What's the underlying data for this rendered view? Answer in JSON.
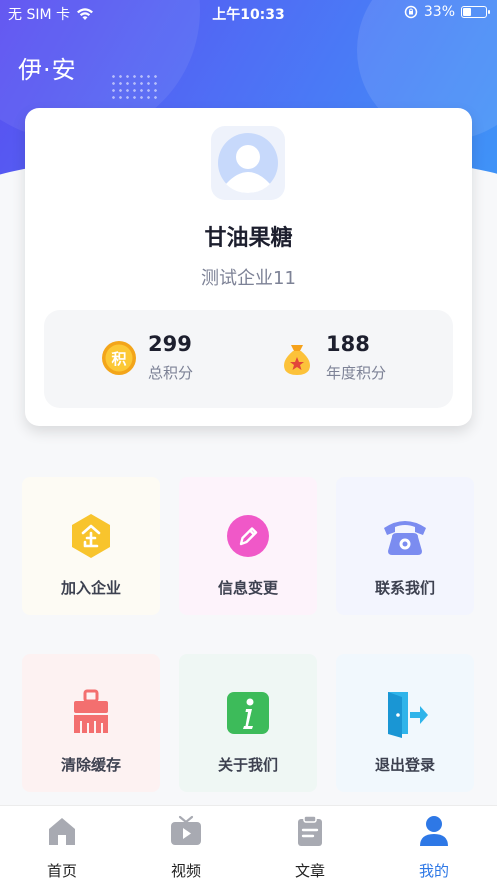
{
  "status_bar": {
    "carrier": "无 SIM 卡",
    "time": "上午10:33",
    "battery": "33%"
  },
  "header": {
    "title": "伊·安"
  },
  "profile": {
    "name": "甘油果糖",
    "company": "测试企业11",
    "total_points": "299",
    "total_points_label": "总积分",
    "annual_points": "188",
    "annual_points_label": "年度积分",
    "coin_badge": "积"
  },
  "menu": [
    {
      "label": "加入企业",
      "icon": "join-company-icon",
      "bg": "#fdfbf4"
    },
    {
      "label": "信息变更",
      "icon": "edit-info-icon",
      "bg": "#fdf3fb"
    },
    {
      "label": "联系我们",
      "icon": "phone-icon",
      "bg": "#f3f5fe"
    },
    {
      "label": "清除缓存",
      "icon": "broom-icon",
      "bg": "#fdf2f2"
    },
    {
      "label": "关于我们",
      "icon": "info-icon",
      "bg": "#eff7f4"
    },
    {
      "label": "退出登录",
      "icon": "logout-icon",
      "bg": "#f1f8fd"
    }
  ],
  "tabbar": [
    {
      "label": "首页",
      "icon": "home-icon",
      "active": false
    },
    {
      "label": "视频",
      "icon": "video-icon",
      "active": false
    },
    {
      "label": "文章",
      "icon": "article-icon",
      "active": false
    },
    {
      "label": "我的",
      "icon": "profile-icon",
      "active": true
    }
  ],
  "colors": {
    "accent": "#2e78e6",
    "gradient_start": "#5a4cf0",
    "gradient_end": "#3f93f7"
  }
}
